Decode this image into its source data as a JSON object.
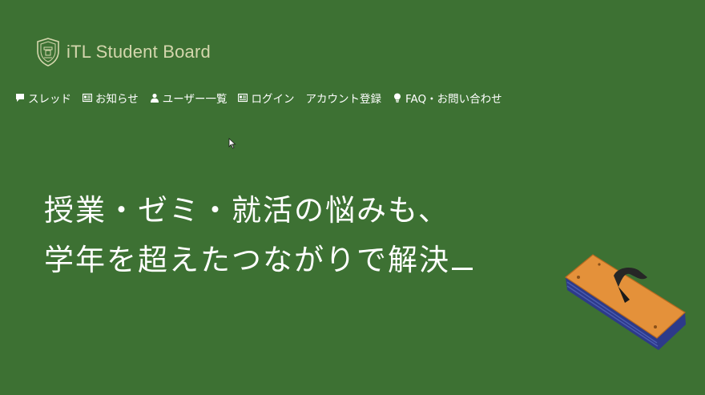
{
  "brand": {
    "title": "iTL Student Board",
    "color": "#d4d6ad"
  },
  "nav": {
    "items": [
      {
        "label": "スレッド",
        "icon": "speech-bubble-icon"
      },
      {
        "label": "お知らせ",
        "icon": "newspaper-icon"
      },
      {
        "label": "ユーザー一覧",
        "icon": "user-icon"
      },
      {
        "label": "ログイン",
        "icon": "newspaper-icon"
      },
      {
        "label": "アカウント登録",
        "icon": ""
      },
      {
        "label": "FAQ・お問い合わせ",
        "icon": "lightbulb-icon"
      }
    ]
  },
  "hero": {
    "line1": "授業・ゼミ・就活の悩みも、",
    "line2": "学年を超えたつながりで解決"
  },
  "colors": {
    "background": "#3d7133",
    "text": "#ffffff",
    "eraser_top": "#e4913a",
    "eraser_side": "#2d3a8a"
  }
}
